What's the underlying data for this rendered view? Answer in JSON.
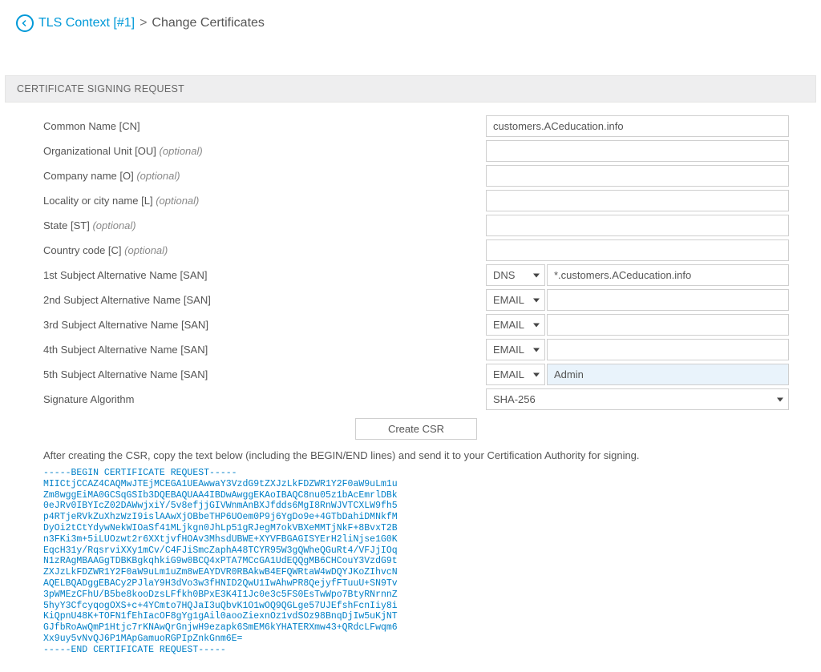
{
  "breadcrumb": {
    "link": "TLS Context [#1]",
    "sep": ">",
    "current": "Change Certificates"
  },
  "section_title": "CERTIFICATE SIGNING REQUEST",
  "labels": {
    "cn": "Common Name [CN]",
    "ou": "Organizational Unit [OU]",
    "o": "Company name [O]",
    "l": "Locality or city name [L]",
    "st": "State [ST]",
    "c": "Country code [C]",
    "san1": "1st Subject Alternative Name [SAN]",
    "san2": "2nd Subject Alternative Name [SAN]",
    "san3": "3rd Subject Alternative Name [SAN]",
    "san4": "4th Subject Alternative Name [SAN]",
    "san5": "5th Subject Alternative Name [SAN]",
    "sigalg": "Signature Algorithm",
    "optional": "(optional)"
  },
  "values": {
    "cn": "customers.ACeducation.info",
    "ou": "",
    "o": "",
    "l": "",
    "st": "",
    "c": "",
    "san1_type": "DNS",
    "san1_val": "*.customers.ACeducation.info",
    "san2_type": "EMAIL",
    "san2_val": "",
    "san3_type": "EMAIL",
    "san3_val": "",
    "san4_type": "EMAIL",
    "san4_val": "",
    "san5_type": "EMAIL",
    "san5_val": "Admin",
    "sigalg": "SHA-256"
  },
  "buttons": {
    "create": "Create CSR"
  },
  "helper": "After creating the CSR, copy the text below (including the BEGIN/END lines) and send it to your Certification Authority for signing.",
  "csr": "-----BEGIN CERTIFICATE REQUEST-----\nMIICtjCCAZ4CAQMwJTEjMCEGA1UEAwwaY3VzdG9tZXJzLkFDZWR1Y2F0aW9uLm1u\nZm8wggEiMA0GCSqGSIb3DQEBAQUAA4IBDwAwggEKAoIBAQC8nu05z1bAcEmrlDBk\n0eJRv0IBYIcZ02DAWwjxiY/5v8efjjGIVWnmAnBXJfdds6MgI8RnWJVTCXLW9fh5\np4RTjeRVkZuXhzWzI9islAAwXjOBbeTHP6UOem0P9j6YgDo9e+4GTbDahiDMNkfM\nDyOi2tCtYdywNekWIOaSf41MLjkgn0JhLp51gRJegM7okVBXeMMTjNkF+8BvxT2B\nn3FKi3m+5iLUOzwt2r6XXtjvfHOAv3MhsdUBWE+XYVFBGAGISYErH2liNjse1G0K\nEqcH31y/RqsrviXXy1mCv/C4FJiSmcZaphA48TCYR95W3gQWheQGuRt4/VFJjIOq\nN1zRAgMBAAGgTDBKBgkqhkiG9w0BCQ4xPTA7MCcGA1UdEQQgMB6CHCouY3VzdG9t\nZXJzLkFDZWR1Y2F0aW9uLm1uZm8wEAYDVR0RBAkwB4EFQWRtaW4wDQYJKoZIhvcN\nAQELBQADggEBACy2PJlaY9H3dVo3w3fHNID2QwU1IwAhwPR8QejyfFTuuU+SN9Tv\n3pWMEzCFhU/B5be8kooDzsLFfkh0BPxE3K4I1Jc0e3c5FS0EsTwWpo7BtyRNrnnZ\n5hyY3CfcyqogOXS+c+4YCmto7HQJaI3uQbvK1O1wOQ9QGLge57UJEfshFcnIiy8i\nKiQpnU48K+TOFN1fEhIacOF8gYg1gAil0aooZiexnOz1vdSOz98BnqDjIw5uKjNT\nGJfbRoAwQmP1Htjc7rKNAwQrGnjwH9ezapk6SmEM6kYHATERXmw43+QRdcLFwqm6\nXx9uy5vNvQJ6P1MApGamuoRGPIpZnkGnm6E=\n-----END CERTIFICATE REQUEST-----"
}
